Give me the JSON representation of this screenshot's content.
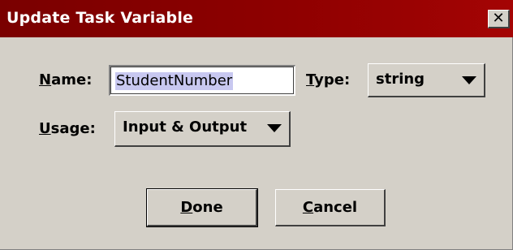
{
  "window": {
    "title": "Update Task Variable",
    "close_glyph": "✕"
  },
  "form": {
    "name": {
      "label_mnemonic": "N",
      "label_rest": "ame:",
      "value": "StudentNumber"
    },
    "type": {
      "label_mnemonic": "T",
      "label_rest": "ype:",
      "selected": "string"
    },
    "usage": {
      "label_mnemonic": "U",
      "label_rest": "sage:",
      "selected": "Input & Output"
    }
  },
  "buttons": {
    "done": {
      "mnemonic": "D",
      "rest": "one"
    },
    "cancel": {
      "mnemonic": "C",
      "rest": "ancel"
    }
  },
  "icons": {
    "close": "close-icon",
    "dropdown": "chevron-down-icon"
  },
  "colors": {
    "titlebar": "#8e0000",
    "dialog_bg": "#d4d0c8",
    "selection_highlight": "#c8c8f0"
  }
}
